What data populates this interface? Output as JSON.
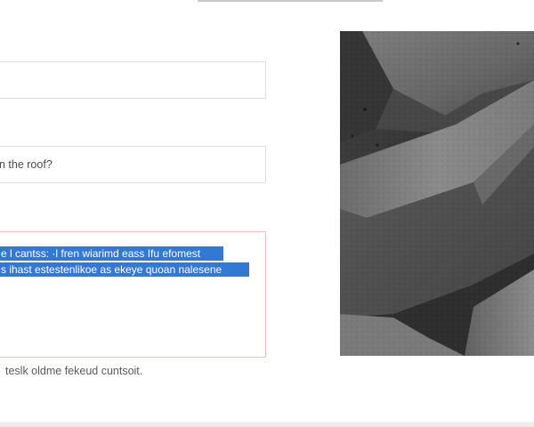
{
  "form": {
    "field_1": {
      "value": ""
    },
    "field_2": {
      "value": "n the roof?"
    },
    "textarea": {
      "selected_line_1": "e l cantss: ·l fren wiarimd eass Ifu efomest",
      "selected_line_2": "s ihast estestenlikoe as ekeye quoan nalesene"
    },
    "helper_text": "teslk oldme fekeud cuntsoit."
  },
  "image": {
    "subject": "grey slate stone slabs"
  }
}
